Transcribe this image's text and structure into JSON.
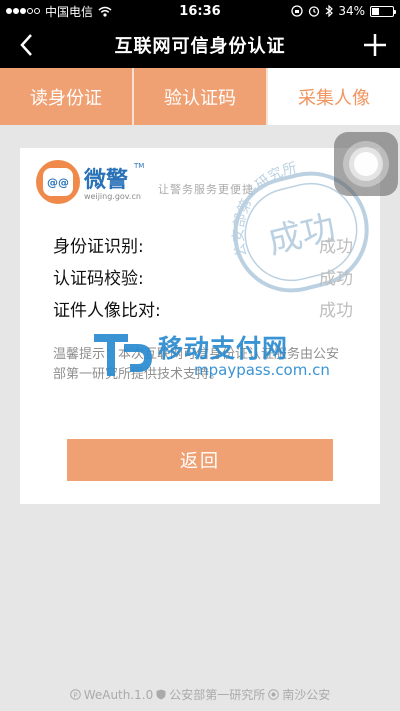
{
  "status_bar": {
    "carrier": "中国电信",
    "time": "16:36",
    "battery_text": "34%",
    "battery_level": 0.34,
    "icons": [
      "signal-dots-icon",
      "wifi-icon",
      "lock-rotation-icon",
      "alarm-icon",
      "bluetooth-icon",
      "battery-icon"
    ]
  },
  "nav": {
    "title": "互联网可信身份认证",
    "icons": [
      "back-arrow-icon",
      "plus-icon"
    ]
  },
  "tabs": [
    {
      "label": "读身份证",
      "active": false
    },
    {
      "label": "验认证码",
      "active": false
    },
    {
      "label": "采集人像",
      "active": true
    }
  ],
  "card": {
    "logo": {
      "inner_text": "@@",
      "name": "微警",
      "tm": "TM",
      "url": "weijing.gov.cn"
    },
    "slogan": "让警务服务更便捷",
    "seal": {
      "top_text": "公安部第一研究所",
      "mid_text": "成功"
    },
    "results": [
      {
        "label": "身份证识别:",
        "value": "成功"
      },
      {
        "label": "认证码校验:",
        "value": "成功"
      },
      {
        "label": "证件人像比对:",
        "value": "成功"
      }
    ],
    "notice": "温馨提示：本次互联网可信身份证认证服务由公安部第一研究所提供技术支持。",
    "watermark": {
      "cn": "移动支付网",
      "url": "mpaypass.com.cn"
    },
    "return_label": "返回"
  },
  "footer": {
    "text1": "WeAuth.1.0",
    "text2": "公安部第一研究所",
    "text3": "南沙公安"
  },
  "colors": {
    "accent": "#f0a173",
    "accent_text": "#f0955f",
    "watermark_blue": "#2a8bd1",
    "seal_blue": "#8fb4cf"
  }
}
